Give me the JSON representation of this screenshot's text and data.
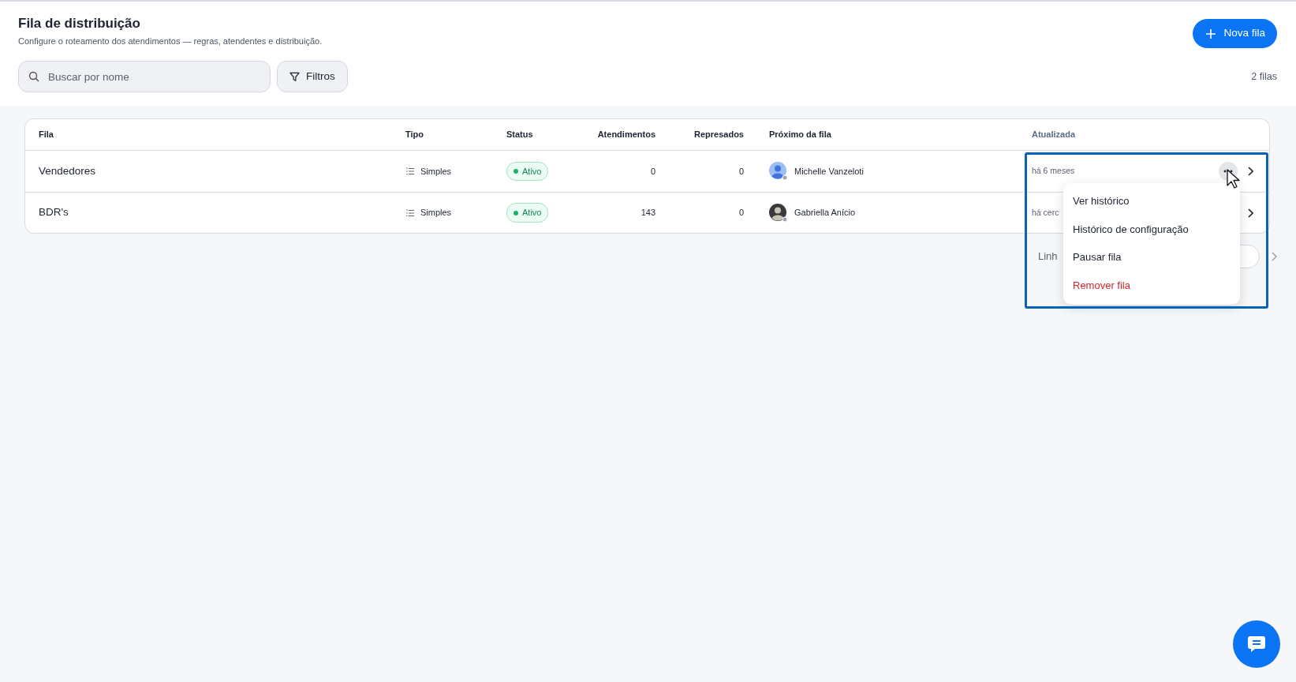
{
  "header": {
    "title": "Fila de distribuição",
    "subtitle": "Configure o roteamento dos atendimentos — regras, atendentes e distribuição.",
    "new_button": "Nova fila",
    "search": {
      "placeholder": "Buscar por nome"
    },
    "filters_button": "Filtros",
    "count": "2 filas"
  },
  "table": {
    "columns": [
      "Fila",
      "Tipo",
      "Status",
      "Atendimentos",
      "Represados",
      "Próximo da fila",
      "Atualizada"
    ],
    "rows": [
      {
        "fila": "Vendedores",
        "tipo": "Simples",
        "status": "Ativo",
        "atendimentos": "0",
        "represados": "0",
        "proximo": "Michelle Vanzeloti",
        "avatar": {
          "kind": "placeholder"
        },
        "atualizada": "há 6 meses",
        "menu_open": true
      },
      {
        "fila": "BDR's",
        "tipo": "Simples",
        "status": "Ativo",
        "atendimentos": "143",
        "represados": "0",
        "proximo": "Gabriella Anício",
        "avatar": {
          "kind": "photo"
        },
        "atualizada": "há cerc",
        "menu_open": false
      }
    ]
  },
  "pagination": {
    "label": "Linh"
  },
  "row_menu": {
    "items": [
      {
        "label": "Ver histórico",
        "kind": "normal"
      },
      {
        "label": "Histórico de configuração",
        "kind": "normal"
      },
      {
        "label": "Pausar fila",
        "kind": "normal"
      },
      {
        "label": "Remover fila",
        "kind": "danger"
      }
    ]
  },
  "highlight_frame": true
}
